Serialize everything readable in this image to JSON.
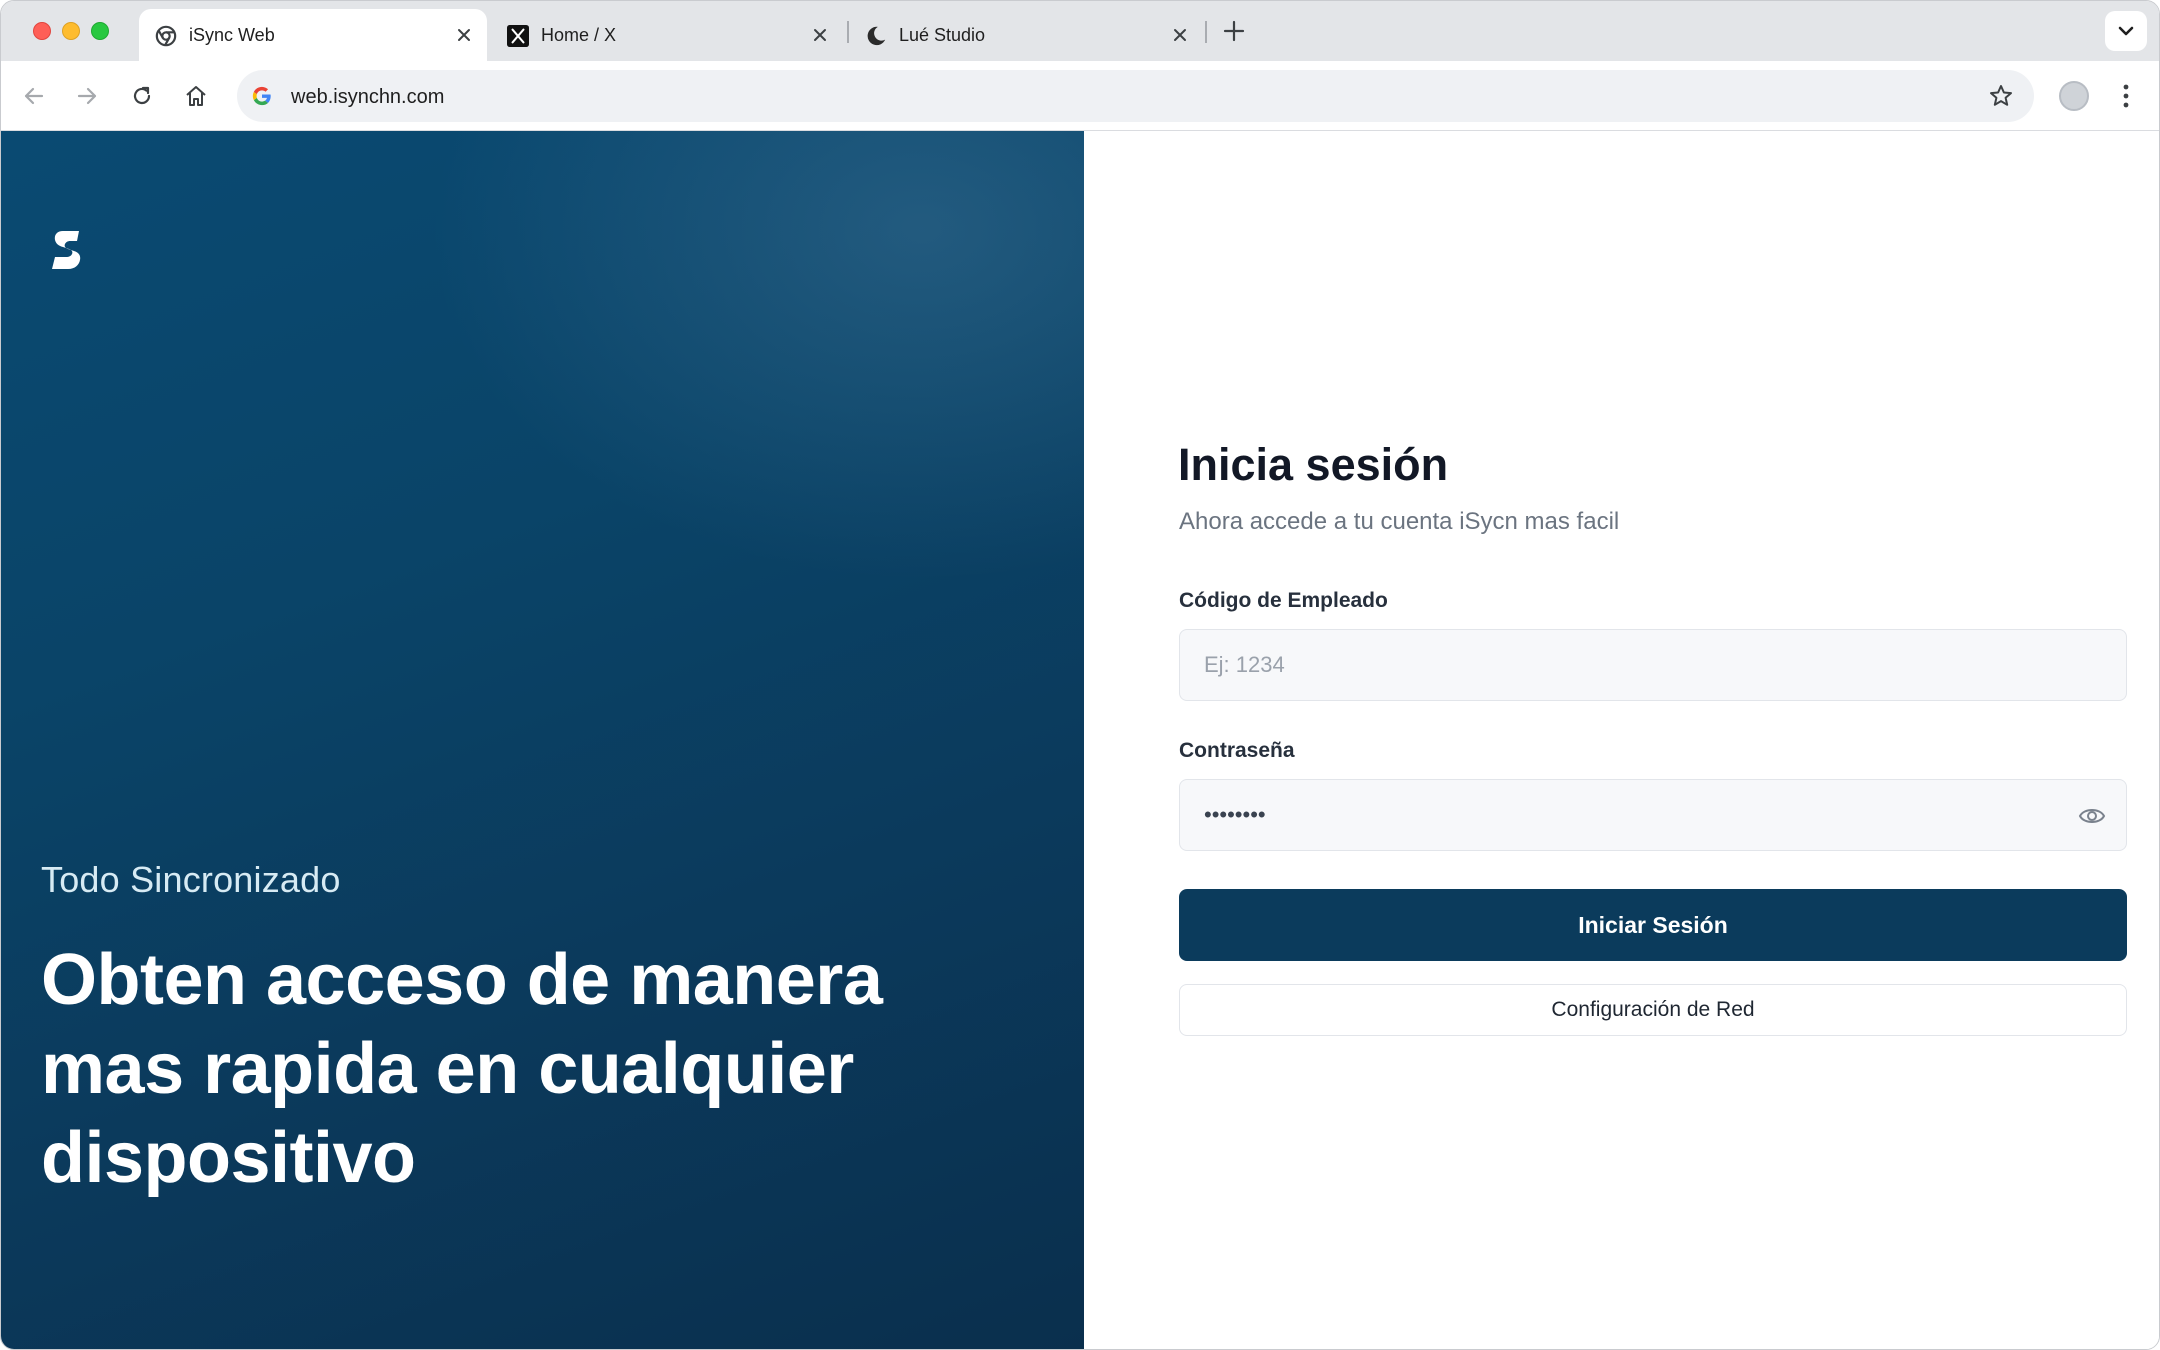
{
  "browser": {
    "tabs": [
      {
        "title": "iSync Web",
        "favicon": "chrome-icon",
        "active": true
      },
      {
        "title": "Home / X",
        "favicon": "x-logo-icon",
        "active": false
      },
      {
        "title": "Lué Studio",
        "favicon": "crescent-icon",
        "active": false
      }
    ],
    "url": "web.isynchn.com"
  },
  "hero": {
    "eyebrow": "Todo Sincronizado",
    "headline": "Obten acceso de manera mas rapida en cualquier dispositivo",
    "logo": "isync-s-logo"
  },
  "login": {
    "title": "Inicia sesión",
    "subtitle": "Ahora accede a tu cuenta iSycn mas facil",
    "employee_label": "Código de Empleado",
    "employee_placeholder": "Ej: 1234",
    "password_label": "Contraseña",
    "password_value": "12345678",
    "submit_label": "Iniciar Sesión",
    "network_label": "Configuración de Red"
  },
  "colors": {
    "primary": "#0b3b5c",
    "hero_bg": "#0a4468"
  }
}
